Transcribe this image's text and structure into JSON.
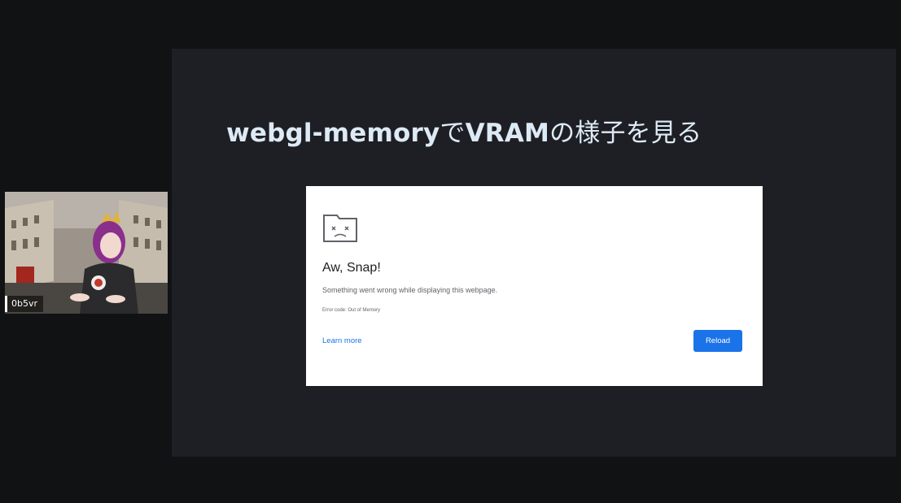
{
  "slide": {
    "title_latin_1": "webgl-memory",
    "title_jp_1": "で",
    "title_latin_2": "VRAM",
    "title_jp_2": "の様子を見る"
  },
  "error_page": {
    "heading": "Aw, Snap!",
    "message": "Something went wrong while displaying this webpage.",
    "error_code": "Error code: Out of Memory",
    "learn_more_label": "Learn more",
    "reload_label": "Reload",
    "icon": "sad-tab-icon"
  },
  "webcam": {
    "streamer_name": "0b5vr"
  },
  "colors": {
    "background": "#111214",
    "slide_background": "#1e1f24",
    "title_text": "#ddeaf5",
    "link": "#1a73e8",
    "button": "#1a73e8"
  }
}
